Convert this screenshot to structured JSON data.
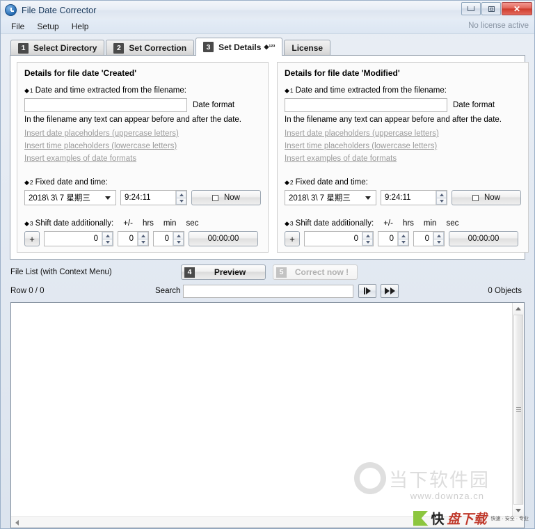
{
  "window": {
    "title": "File Date Corrector",
    "icon": "clock-icon",
    "minimize_label": "Minimize",
    "maximize_label": "Maximize",
    "close_label": "✕"
  },
  "menubar": {
    "items": [
      {
        "label": "File"
      },
      {
        "label": "Setup"
      },
      {
        "label": "Help"
      }
    ],
    "license_note": "No license active"
  },
  "tabs": [
    {
      "num": "1",
      "label": "Select Directory",
      "active": false
    },
    {
      "num": "2",
      "label": "Set Correction",
      "active": false
    },
    {
      "num": "3",
      "label": "Set Details",
      "sup": "◆¹²³",
      "active": true
    },
    {
      "num": "",
      "label": "License",
      "active": false
    }
  ],
  "panels": [
    {
      "title": "Details for file date 'Created'",
      "section1_label": "Date and time extracted from the filename:",
      "section1_marker": "◆",
      "section1_sup": "1",
      "filename_value": "",
      "filename_placeholder": "",
      "date_format_label": "Date format",
      "hint": "In the filename any text can appear before and after the date.",
      "links": [
        "Insert date placeholders (uppercase letters)",
        "Insert time placeholders (lowercase letters)",
        "Insert examples of date formats"
      ],
      "section2_label": "Fixed date and time:",
      "section2_marker": "◆",
      "section2_sup": "2",
      "date_value": "2018\\  3\\  7 星期三",
      "time_value": "9:24:11",
      "now_label": "Now",
      "section3_label": "Shift date additionally:",
      "section3_marker": "◆",
      "section3_sup": "3",
      "shift_units": [
        "+/-",
        "hrs",
        "min",
        "sec"
      ],
      "plus_label": "+",
      "shift_hrs": "0",
      "shift_min": "0",
      "shift_sec": "0",
      "shift_total": "00:00:00"
    },
    {
      "title": "Details for file date 'Modified'",
      "section1_label": "Date and time extracted from the filename:",
      "section1_marker": "◆",
      "section1_sup": "1",
      "filename_value": "",
      "filename_placeholder": "",
      "date_format_label": "Date format",
      "hint": "In the filename any text can appear before and after the date.",
      "links": [
        "Insert date placeholders (uppercase letters)",
        "Insert time placeholders (lowercase letters)",
        "Insert examples of date formats"
      ],
      "section2_label": "Fixed date and time:",
      "section2_marker": "◆",
      "section2_sup": "2",
      "date_value": "2018\\  3\\  7 星期三",
      "time_value": "9:24:11",
      "now_label": "Now",
      "section3_label": "Shift date additionally:",
      "section3_marker": "◆",
      "section3_sup": "3",
      "shift_units": [
        "+/-",
        "hrs",
        "min",
        "sec"
      ],
      "plus_label": "+",
      "shift_hrs": "0",
      "shift_min": "0",
      "shift_sec": "0",
      "shift_total": "00:00:00"
    }
  ],
  "filelist": {
    "label": "File List (with Context Menu)",
    "preview_num": "4",
    "preview_label": "Preview",
    "correct_num": "5",
    "correct_label": "Correct now !",
    "row_status": "Row 0 / 0",
    "search_label": "Search",
    "search_value": "",
    "search_placeholder": "",
    "nav_first_icon": "go-to-first-icon",
    "nav_next_icon": "go-forward-icon",
    "objects_count": "0 Objects"
  },
  "watermarks": {
    "site_name": "当下软件园",
    "site_url": "www.downza.cn",
    "partner_name": "快盘下载",
    "partner_sub": "快速 · 安全 · 专业"
  },
  "colors": {
    "accent": "#2a6fb5",
    "close_red": "#cf3c2c",
    "tab_badge": "#4a4a4a",
    "disabled_text": "#b0b0b0",
    "link_text": "#9a9a9a"
  }
}
